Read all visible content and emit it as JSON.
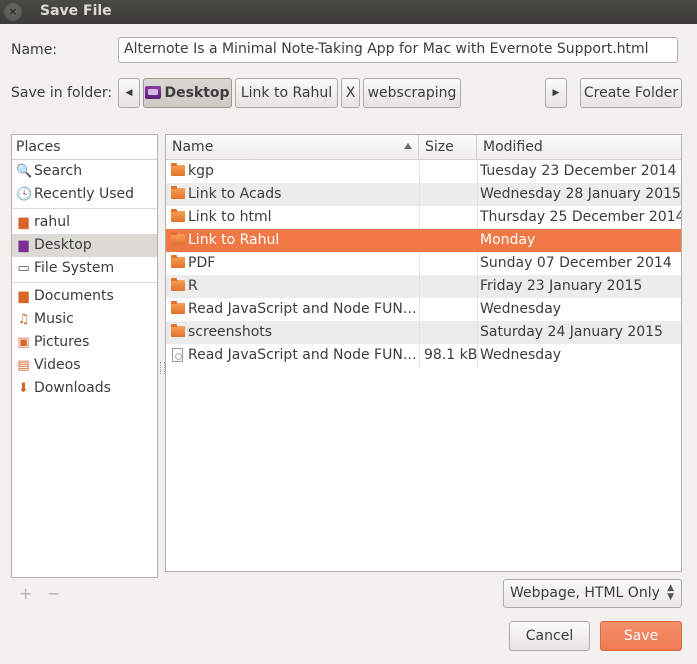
{
  "window": {
    "title": "Save File",
    "close_glyph": "×"
  },
  "name_field": {
    "label": "Name:",
    "value": "Alternote Is a Minimal Note-Taking App for Mac with Evernote Support.html"
  },
  "folder": {
    "label": "Save in folder:",
    "crumbs": [
      "Desktop",
      "Link to Rahul",
      "X",
      "webscraping"
    ],
    "create_folder": "Create Folder"
  },
  "places": {
    "header": "Places",
    "items": [
      {
        "label": "Search",
        "icon": "search-icon"
      },
      {
        "label": "Recently Used",
        "icon": "clock-icon"
      },
      {
        "label": "rahul",
        "icon": "home-folder-icon"
      },
      {
        "label": "Desktop",
        "icon": "desktop-icon"
      },
      {
        "label": "File System",
        "icon": "drive-icon"
      },
      {
        "label": "Documents",
        "icon": "documents-icon"
      },
      {
        "label": "Music",
        "icon": "music-icon"
      },
      {
        "label": "Pictures",
        "icon": "pictures-icon"
      },
      {
        "label": "Videos",
        "icon": "videos-icon"
      },
      {
        "label": "Downloads",
        "icon": "downloads-icon"
      }
    ],
    "add": "+",
    "remove": "−"
  },
  "files": {
    "columns": {
      "name": "Name",
      "size": "Size",
      "modified": "Modified"
    },
    "rows": [
      {
        "name": "kgp",
        "size": "",
        "modified": "Tuesday 23 December 2014",
        "type": "folder"
      },
      {
        "name": "Link to Acads",
        "size": "",
        "modified": "Wednesday 28 January 2015",
        "type": "folder"
      },
      {
        "name": "Link to html",
        "size": "",
        "modified": "Thursday 25 December 2014",
        "type": "folder"
      },
      {
        "name": "Link to Rahul",
        "size": "",
        "modified": "Monday",
        "type": "folder"
      },
      {
        "name": "PDF",
        "size": "",
        "modified": "Sunday 07 December 2014",
        "type": "folder"
      },
      {
        "name": "R",
        "size": "",
        "modified": "Friday 23 January 2015",
        "type": "folder"
      },
      {
        "name": "Read JavaScript and Node FUN…",
        "size": "",
        "modified": "Wednesday",
        "type": "folder"
      },
      {
        "name": "screenshots",
        "size": "",
        "modified": "Saturday 24 January 2015",
        "type": "folder"
      },
      {
        "name": "Read JavaScript and Node FUN…",
        "size": "98.1 kB",
        "modified": "Wednesday",
        "type": "file"
      }
    ]
  },
  "filter": {
    "selected": "Webpage, HTML Only"
  },
  "actions": {
    "cancel": "Cancel",
    "save": "Save"
  },
  "colors": {
    "accent": "#f07746",
    "titlebar": "#3c3b37"
  }
}
